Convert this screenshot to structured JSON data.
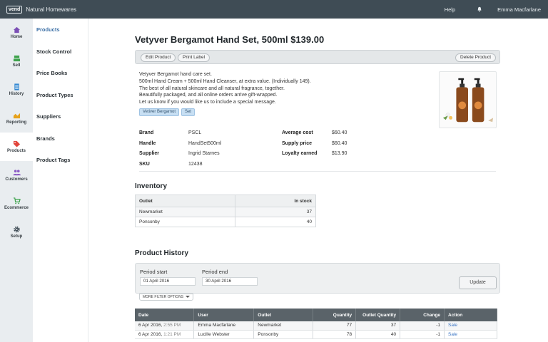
{
  "app": {
    "logo_text": "vend",
    "store_name": "Natural Homewares",
    "help_label": "Help",
    "bell_icon": "bell-icon",
    "user_name": "Emma Macfarlane"
  },
  "nav": [
    {
      "label": "Home",
      "icon": "home-icon"
    },
    {
      "label": "Sell",
      "icon": "register-icon"
    },
    {
      "label": "History",
      "icon": "history-icon"
    },
    {
      "label": "Reporting",
      "icon": "chart-icon"
    },
    {
      "label": "Products",
      "icon": "tag-icon",
      "active": true
    },
    {
      "label": "Customers",
      "icon": "people-icon"
    },
    {
      "label": "Ecommerce",
      "icon": "cart-icon"
    },
    {
      "label": "Setup",
      "icon": "gear-icon"
    }
  ],
  "submenu": [
    "Products",
    "Stock Control",
    "Price Books",
    "Product Types",
    "Suppliers",
    "Brands",
    "Product Tags"
  ],
  "product": {
    "title": "Vetyver Bergamot Hand Set, 500ml  $139.00",
    "buttons": {
      "edit": "Edit Product",
      "print": "Print Label",
      "delete": "Delete Product"
    },
    "description": [
      "Vetyver Bergamot hand care set.",
      "500ml Hand Cream + 500ml Hand Cleanser, at extra value. (Individually 149).",
      "The best of all natural skincare and all natural fragrance, together.",
      "Beautifully packaged, and all online orders arrive gift-wrapped.",
      "Let us know if you would like us to include a special message."
    ],
    "tags": [
      "Vetiver Bergamot",
      "Set"
    ],
    "details_left": [
      {
        "label": "Brand",
        "value": "PSCL"
      },
      {
        "label": "Handle",
        "value": "HandSet500ml"
      },
      {
        "label": "Supplier",
        "value": "Ingrid Starnes"
      },
      {
        "label": "SKU",
        "value": "12438"
      }
    ],
    "details_right": [
      {
        "label": "Average cost",
        "value": "$60.40"
      },
      {
        "label": "Supply price",
        "value": "$60.40"
      },
      {
        "label": "Loyalty earned",
        "value": "$13.90"
      }
    ]
  },
  "inventory": {
    "title": "Inventory",
    "columns": [
      "Outlet",
      "In stock"
    ],
    "rows": [
      {
        "outlet": "Newmarket",
        "stock": "37"
      },
      {
        "outlet": "Ponsonby",
        "stock": "40"
      }
    ]
  },
  "history": {
    "title": "Product History",
    "period_start_label": "Period start",
    "period_start_value": "01 April 2016",
    "period_end_label": "Period end",
    "period_end_value": "30 April 2016",
    "update_label": "Update",
    "more_filters_label": "MORE FILTER OPTIONS",
    "columns": [
      "Date",
      "User",
      "Outlet",
      "Quantity",
      "Outlet Quantity",
      "Change",
      "Action"
    ],
    "rows": [
      {
        "date": "6 Apr 2016,",
        "time": "2:55 PM",
        "user": "Emma Macfarlane",
        "outlet": "Newmarket",
        "quantity": "77",
        "outlet_quantity": "37",
        "change": "-1",
        "action": "Sale"
      },
      {
        "date": "6 Apr 2016,",
        "time": "1:21 PM",
        "user": "Lucille Webster",
        "outlet": "Ponsonby",
        "quantity": "78",
        "outlet_quantity": "40",
        "change": "-1",
        "action": "Sale"
      }
    ]
  }
}
